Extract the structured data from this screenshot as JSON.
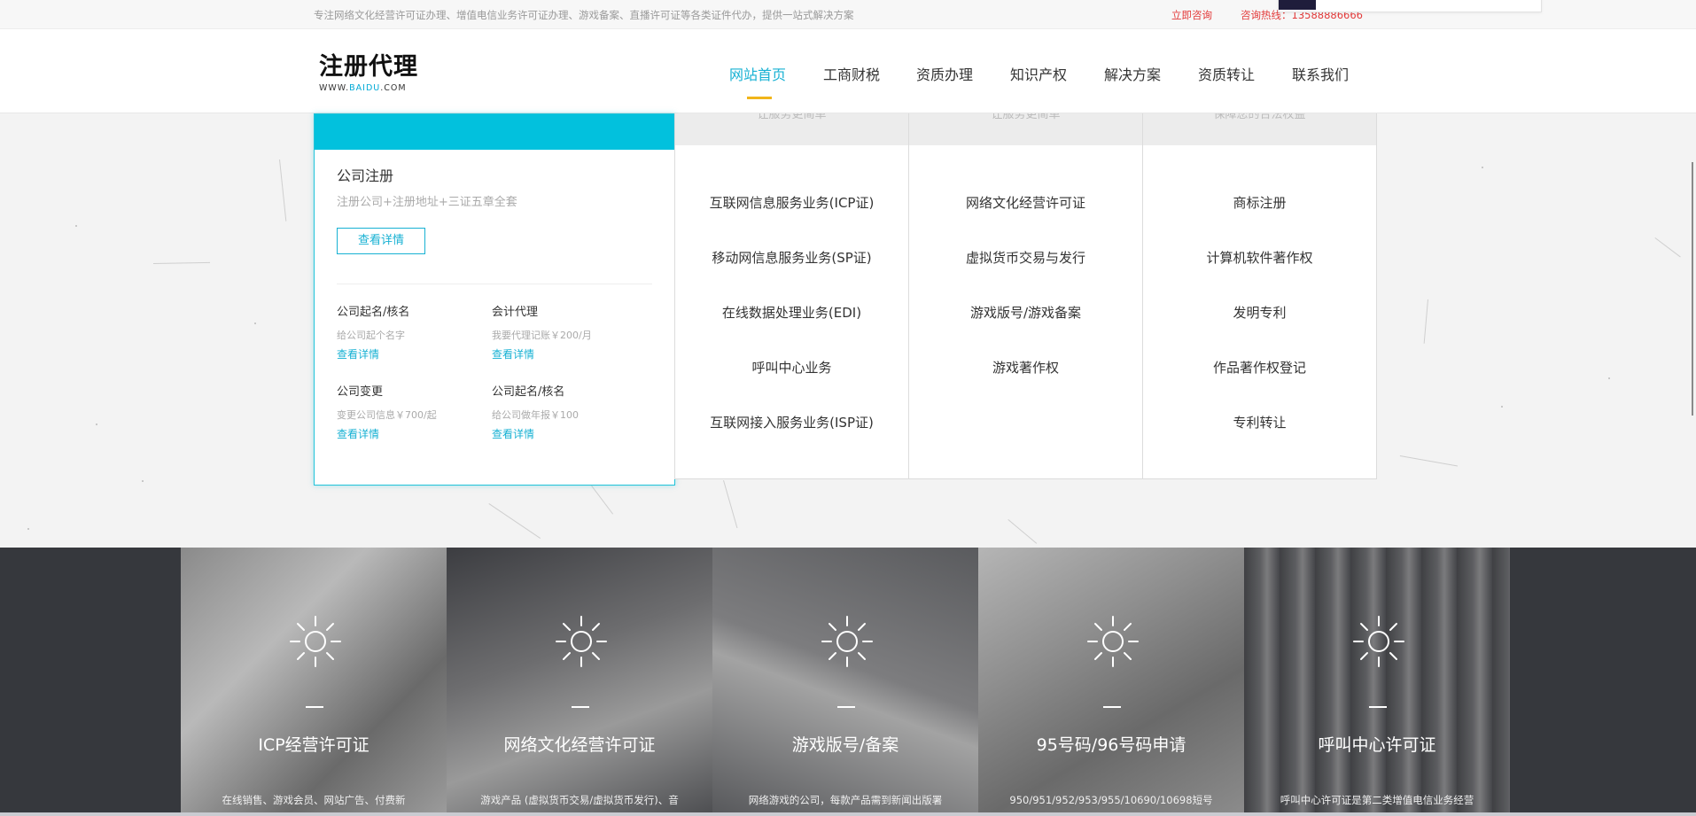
{
  "topbar": {
    "slogan": "专注网络文化经营许可证办理、增值电信业务许可证办理、游戏备案、直播许可证等各类证件代办，提供一站式解决方案",
    "consult_label": "立即咨询",
    "hotline": "咨询热线：13588886666"
  },
  "header": {
    "logo_main": "注册代理",
    "logo_sub_prefix": "WWW.",
    "logo_sub_highlight": "BAIDU",
    "logo_sub_suffix": ".COM",
    "nav": [
      "网站首页",
      "工商财税",
      "资质办理",
      "知识产权",
      "解决方案",
      "资质转让",
      "联系我们"
    ],
    "active_nav": "网站首页",
    "accent_color": "#17b1d3",
    "underline_color": "#f1b519"
  },
  "company_card": {
    "title": "公司注册",
    "desc": "注册公司+注册地址+三证五章全套",
    "button": "查看详情",
    "items": [
      {
        "title": "公司起名/核名",
        "desc": "给公司起个名字",
        "link": "查看详情"
      },
      {
        "title": "会计代理",
        "desc": "我要代理记账￥200/月",
        "link": "查看详情"
      },
      {
        "title": "公司变更",
        "desc": "变更公司信息￥700/起",
        "link": "查看详情"
      },
      {
        "title": "公司起名/核名",
        "desc": "给公司做年报￥100",
        "link": "查看详情"
      }
    ]
  },
  "service_columns": [
    {
      "header": "让服务更简单",
      "items": [
        "互联网信息服务业务(ICP证)",
        "移动网信息服务业务(SP证)",
        "在线数据处理业务(EDI)",
        "呼叫中心业务",
        "互联网接入服务业务(ISP证)"
      ]
    },
    {
      "header": "让服务更简单",
      "items": [
        "网络文化经营许可证",
        "虚拟货币交易与发行",
        "游戏版号/游戏备案",
        "游戏著作权"
      ]
    },
    {
      "header": "保障您的合法权益",
      "items": [
        "商标注册",
        "计算机软件著作权",
        "发明专利",
        "作品著作权登记",
        "专利转让"
      ]
    }
  ],
  "panels": [
    {
      "title": "ICP经营许可证",
      "desc": "在线销售、游戏会员、网站广告、付费新",
      "icon": "sun-icon"
    },
    {
      "title": "网络文化经营许可证",
      "desc": "游戏产品 (虚拟货币交易/虚拟货币发行)、音",
      "icon": "sun-icon"
    },
    {
      "title": "游戏版号/备案",
      "desc": "网络游戏的公司，每款产品需到新闻出版署",
      "icon": "sun-icon"
    },
    {
      "title": "95号码/96号码申请",
      "desc": "950/951/952/953/955/10690/10698短号",
      "icon": "sun-icon"
    },
    {
      "title": "呼叫中心许可证",
      "desc": "呼叫中心许可证是第二类增值电信业务经营",
      "icon": "sun-icon"
    }
  ]
}
